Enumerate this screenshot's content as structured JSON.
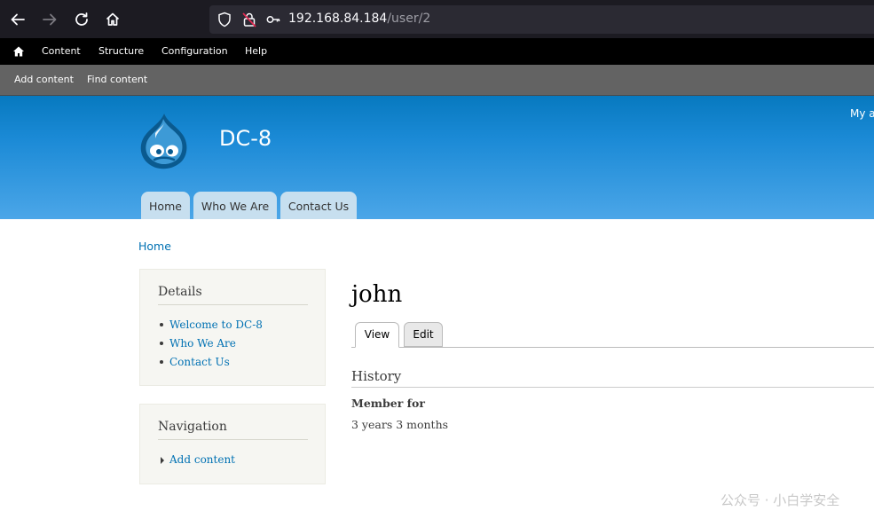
{
  "browser": {
    "url_host": "192.168.84.184",
    "url_path": "/user/2"
  },
  "admin_menu": {
    "items": [
      "Content",
      "Structure",
      "Configuration",
      "Help"
    ]
  },
  "shortcuts": {
    "items": [
      "Add content",
      "Find content"
    ]
  },
  "header": {
    "site_name": "DC-8",
    "my_account": "My a",
    "tabs": [
      "Home",
      "Who We Are",
      "Contact Us"
    ]
  },
  "breadcrumb": "Home",
  "sidebar": {
    "details": {
      "title": "Details",
      "links": [
        "Welcome to DC-8",
        "Who We Are",
        "Contact Us"
      ]
    },
    "navigation": {
      "title": "Navigation",
      "links": [
        "Add content"
      ]
    }
  },
  "main": {
    "title": "john",
    "tabs": [
      "View",
      "Edit"
    ],
    "section": "History",
    "field_label": "Member for",
    "field_value": "3 years 3 months"
  },
  "watermark": "公众号 · 小白学安全"
}
